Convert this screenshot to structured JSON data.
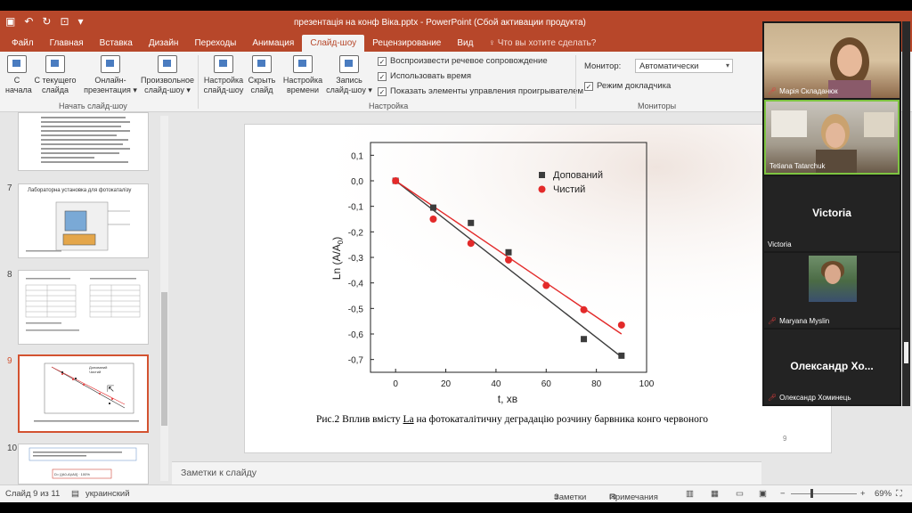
{
  "window": {
    "title": "презентація на конф Віка.pptx - PowerPoint (Сбой активации продукта)"
  },
  "tabs": [
    "Файл",
    "Главная",
    "Вставка",
    "Дизайн",
    "Переходы",
    "Анимация",
    "Слайд-шоу",
    "Рецензирование",
    "Вид"
  ],
  "active_tab": "Слайд-шоу",
  "tell_me": "Что вы хотите сделать?",
  "ribbon": {
    "start_group": {
      "label": "Начать слайд-шоу",
      "from_start_1": "С",
      "from_start_2": "начала",
      "from_current_1": "С текущего",
      "from_current_2": "слайда",
      "online_1": "Онлайн-",
      "online_2": "презентация ▾",
      "custom_1": "Произвольное",
      "custom_2": "слайд-шоу ▾"
    },
    "setup_group": {
      "label": "Настройка",
      "setup_1": "Настройка",
      "setup_2": "слайд-шоу",
      "hide_1": "Скрыть",
      "hide_2": "слайд",
      "timing_1": "Настройка",
      "timing_2": "времени",
      "record_1": "Запись",
      "record_2": "слайд-шоу ▾",
      "check_narration": "Воспроизвести речевое сопровождение",
      "check_timings": "Использовать время",
      "check_controls": "Показать элементы управления проигрывателем"
    },
    "monitors_group": {
      "label": "Мониторы",
      "monitor_label": "Монитор:",
      "monitor_value": "Автоматически",
      "presenter_view": "Режим докладчика"
    }
  },
  "thumbnails": [
    {
      "number": "7",
      "title": "Лабораторна установка для фотокаталізу"
    },
    {
      "number": "8"
    },
    {
      "number": "9",
      "legend_1": "Допований",
      "legend_2": "Чистий"
    },
    {
      "number": "10",
      "formula": "D= [(A0-A)/A0] · 100%"
    }
  ],
  "slide": {
    "caption_prefix": "Рис.2 Вплив вмісту ",
    "caption_la": "La",
    "caption_suffix": " на фотокаталітичну деградацію розчину барвника конго червоного",
    "page_number": "9"
  },
  "chart_data": {
    "type": "scatter",
    "xlabel": "t, хв",
    "ylabel": "Ln (A/A",
    "ylabel_sub": "0",
    "ylabel_close": ")",
    "xlim": [
      -10,
      100
    ],
    "ylim": [
      -0.75,
      0.15
    ],
    "xticks": [
      0,
      20,
      40,
      60,
      80,
      100
    ],
    "yticks": [
      0.1,
      0.0,
      -0.1,
      -0.2,
      -0.3,
      -0.4,
      -0.5,
      -0.6,
      -0.7
    ],
    "ytick_labels": [
      "0,1",
      "0,0",
      "-0,1",
      "-0,2",
      "-0,3",
      "-0,4",
      "-0,5",
      "-0,6",
      "-0,7"
    ],
    "xtick_labels": [
      "0",
      "20",
      "40",
      "60",
      "80",
      "100"
    ],
    "legend_position": "top-right",
    "series": [
      {
        "name": "Допований",
        "marker": "square",
        "color": "#3c3c3c",
        "x": [
          0,
          15,
          30,
          45,
          75,
          90
        ],
        "y": [
          0.0,
          -0.105,
          -0.165,
          -0.28,
          -0.62,
          -0.685
        ],
        "fit": [
          [
            0,
            0.0
          ],
          [
            90,
            -0.69
          ]
        ]
      },
      {
        "name": "Чистий",
        "marker": "circle",
        "color": "#e32a2a",
        "x": [
          0,
          15,
          30,
          45,
          60,
          75,
          90
        ],
        "y": [
          0.0,
          -0.15,
          -0.245,
          -0.31,
          -0.41,
          -0.505,
          -0.565
        ],
        "fit": [
          [
            0,
            0.0
          ],
          [
            90,
            -0.6
          ]
        ]
      }
    ]
  },
  "notes": {
    "placeholder": "Заметки к слайду"
  },
  "status": {
    "slide_info": "Слайд 9 из 11",
    "language": "украинский",
    "notes_btn": "Заметки",
    "comments_btn": "Примечания",
    "zoom": "69%"
  },
  "participants": [
    {
      "name": "Марія Складанюк",
      "muted": true
    },
    {
      "name": "Tetiana Tatarchuk",
      "muted": false
    },
    {
      "name": "Victoria",
      "display": "Victoria",
      "muted": false
    },
    {
      "name": "Maryana Myslin",
      "muted": true
    },
    {
      "name": "Олександр Хоминець",
      "display": "Олександр Хо...",
      "muted": true
    }
  ],
  "colors": {
    "accent": "#b7472a",
    "series_black": "#3c3c3c",
    "series_red": "#e32a2a",
    "active_speaker": "#7ec441"
  }
}
